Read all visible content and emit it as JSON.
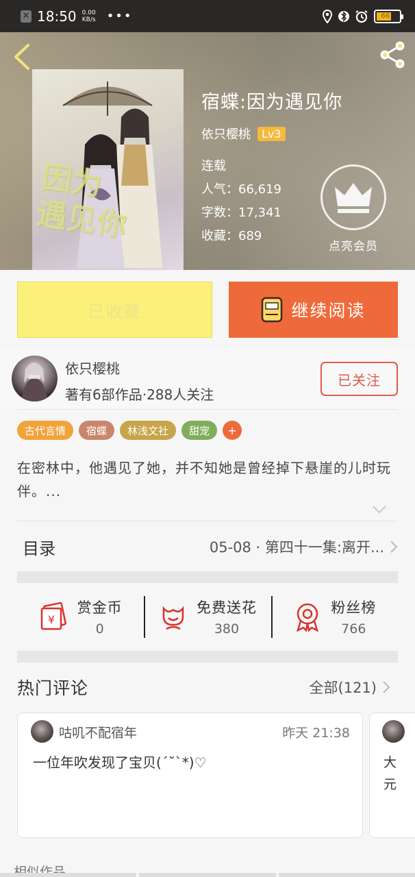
{
  "status_bar": {
    "time": "18:50",
    "net_speed_value": "0.00",
    "net_speed_unit": "KB/s",
    "more": "•••",
    "battery": "66",
    "battery_level": 0.66,
    "icons": [
      "location-icon",
      "bluetooth-icon",
      "alarm-icon",
      "battery-icon"
    ]
  },
  "book": {
    "title": "宿蝶:因为遇见你",
    "author": "依只樱桃",
    "level": "Lv3",
    "status": "连载",
    "popularity_label": "人气：",
    "popularity": "66,619",
    "words_label": "字数：",
    "words": "17,341",
    "favorites_label": "收藏：",
    "favorites": "689",
    "vip_label": "点亮会员",
    "cover_title_1": "因为",
    "cover_title_2": "遇见你"
  },
  "actions": {
    "favorited": "已收藏",
    "continue_reading": "继续阅读"
  },
  "author": {
    "name": "依只樱桃",
    "stats": "著有6部作品·288人关注",
    "follow_label": "已关注"
  },
  "tags": [
    {
      "label": "古代言情",
      "color": "#f2a33a"
    },
    {
      "label": "宿蝶",
      "color": "#c9866a"
    },
    {
      "label": "林浅文社",
      "color": "#c8a44a"
    },
    {
      "label": "甜宠",
      "color": "#7fae5b"
    },
    {
      "label": "+",
      "color": "#ef6a3b"
    }
  ],
  "summary": "在密林中，他遇见了她，并不知她是曾经掉下悬崖的儿时玩伴。...",
  "toc": {
    "label": "目录",
    "latest": "05-08 · 第四十一集:离开..."
  },
  "stats": [
    {
      "label": "赏金币",
      "value": "0",
      "icon": "coin-envelope-icon"
    },
    {
      "label": "免费送花",
      "value": "380",
      "icon": "flower-icon"
    },
    {
      "label": "粉丝榜",
      "value": "766",
      "icon": "medal-icon"
    }
  ],
  "comments": {
    "title": "热门评论",
    "all_label": "全部(121)",
    "items": [
      {
        "user": "咕叽不配宿年",
        "time": "昨天 21:38",
        "text": "一位年吹发现了宝贝(´˘`*)♡"
      },
      {
        "text_line1": "大",
        "text_line2": "元"
      }
    ]
  },
  "similar_label": "相似作品",
  "colors": {
    "accent_orange": "#ef6a3b",
    "favorite_yellow": "#fbf07a",
    "follow_red": "#e05a4a",
    "level_badge": "#f6b93b"
  }
}
